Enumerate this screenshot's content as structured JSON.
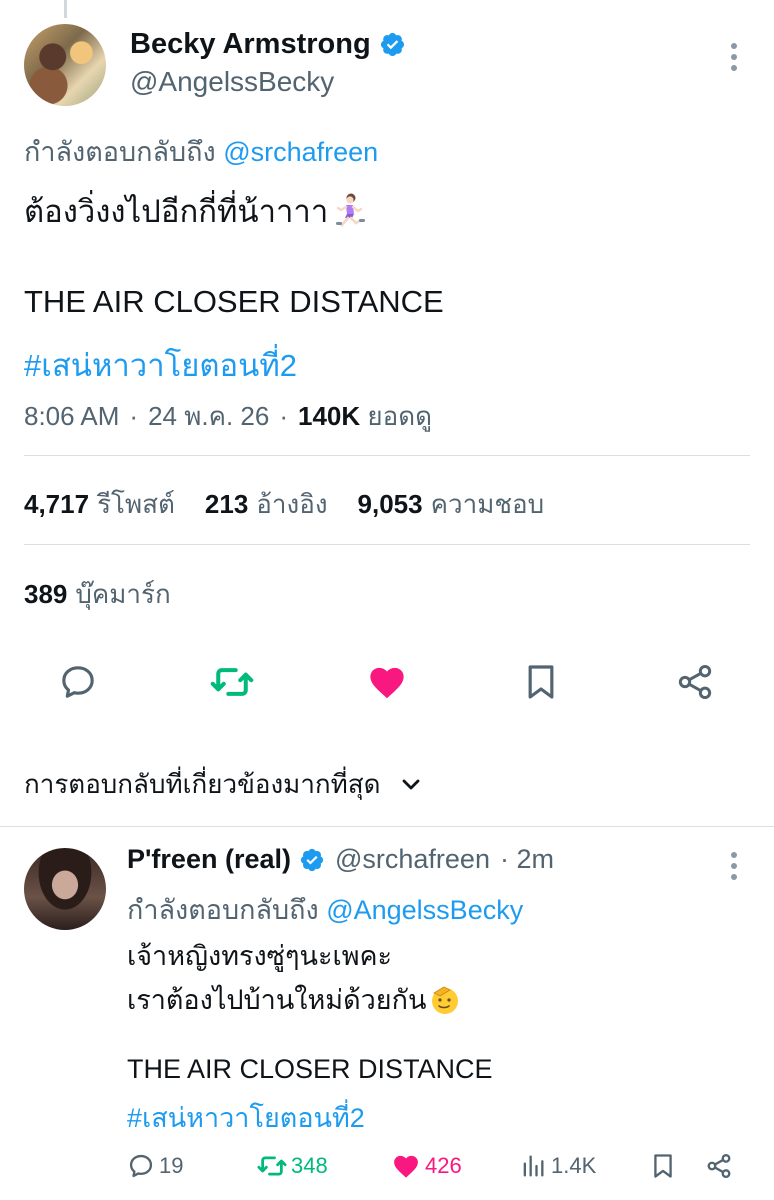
{
  "main_tweet": {
    "display_name": "Becky Armstrong",
    "handle": "@AngelssBecky",
    "replying_prefix": "กำลังตอบกลับถึง",
    "replying_to": "@srchafreen",
    "text_line1": "ต้องวิ่งงไปอีกกี่ที่น้าาาา",
    "text_line2": "THE AIR CLOSER DISTANCE",
    "hashtag": "#เสน่หาวาโยตอนที่2",
    "time": "8:06 AM",
    "date": "24 พ.ค. 26",
    "views_count": "140K",
    "views_label": "ยอดดู",
    "reposts_count": "4,717",
    "reposts_label": "รีโพสต์",
    "quotes_count": "213",
    "quotes_label": "อ้างอิง",
    "likes_count": "9,053",
    "likes_label": "ความชอบ",
    "bookmarks_count": "389",
    "bookmarks_label": "บุ๊คมาร์ก"
  },
  "sort": {
    "label": "การตอบกลับที่เกี่ยวข้องมากที่สุด"
  },
  "reply_tweet": {
    "display_name": "P'freen (real)",
    "handle": "@srchafreen",
    "time": "· 2m",
    "replying_prefix": "กำลังตอบกลับถึง",
    "replying_to": "@AngelssBecky",
    "text_line1": "เจ้าหญิงทรงซู่ๆนะเพคะ",
    "text_line2": "เราต้องไปบ้านใหม่ด้วยกัน",
    "text_line3": "THE AIR CLOSER DISTANCE",
    "hashtag": "#เสน่หาวาโยตอนที่2",
    "replies": "19",
    "reposts": "348",
    "likes": "426",
    "views": "1.4K"
  },
  "colors": {
    "accent": "#1d9bf0",
    "retweet": "#00ba7c",
    "like": "#f91880",
    "muted": "#536471"
  }
}
